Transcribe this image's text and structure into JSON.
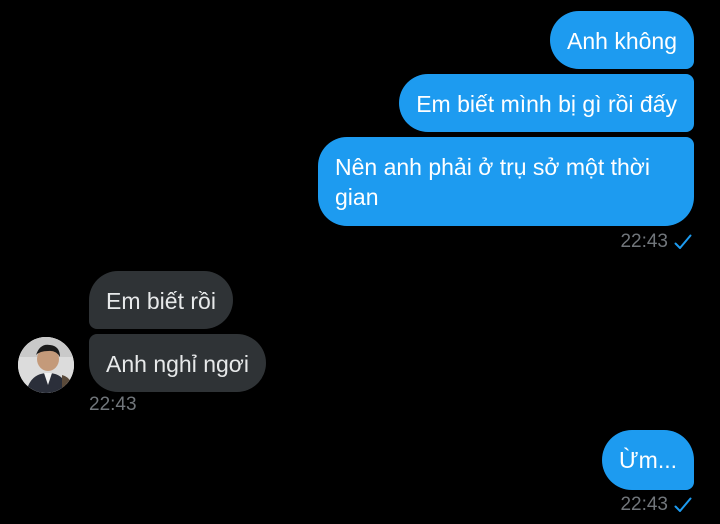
{
  "conversation": {
    "messages": [
      {
        "direction": "outgoing",
        "text": "Anh không"
      },
      {
        "direction": "outgoing",
        "text": "Em biết mình bị gì rồi đấy"
      },
      {
        "direction": "outgoing",
        "text": "Nên anh phải ở trụ sở một thời gian"
      },
      {
        "direction": "incoming",
        "text": "Em biết rồi"
      },
      {
        "direction": "incoming",
        "text": "Anh nghỉ ngơi"
      },
      {
        "direction": "outgoing",
        "text": "Ừm..."
      }
    ],
    "timestamps": {
      "first_outgoing_group": "22:43",
      "incoming_group": "22:43",
      "last_outgoing": "22:43"
    },
    "read_status_icon": "check-icon",
    "contact_avatar_icon": "avatar"
  },
  "colors": {
    "background": "#000000",
    "outgoing_bubble": "#1d9bf0",
    "incoming_bubble": "#2f3336",
    "timestamp": "#71767b"
  }
}
